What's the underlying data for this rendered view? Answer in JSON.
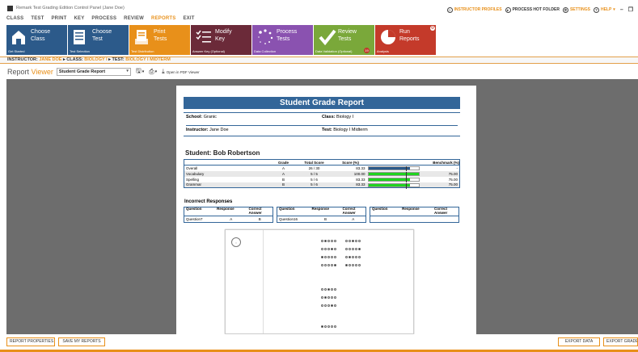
{
  "window": {
    "title": "Remark Test Grading Edition Control Panel (Jane Doe)"
  },
  "top_right": {
    "instructor_profiles": "INSTRUCTOR PROFILES",
    "process_hot_folder": "PROCESS HOT FOLDER",
    "settings": "SETTINGS",
    "help": "HELP"
  },
  "menu": [
    "CLASS",
    "TEST",
    "PRINT",
    "KEY",
    "PROCESS",
    "REVIEW",
    "REPORTS",
    "EXIT"
  ],
  "menu_active": "REPORTS",
  "ribbon": [
    {
      "label": "Choose\nClass",
      "sub": "Get Started",
      "color": "#2c5a8a",
      "icon": "house-icon"
    },
    {
      "label": "Choose\nTest",
      "sub": "Test Selection",
      "color": "#2c5a8a",
      "icon": "document-icon"
    },
    {
      "label": "Print\nTests",
      "sub": "Test Distribution",
      "color": "#e8901a",
      "icon": "printer-doc-icon"
    },
    {
      "label": "Modify\nKey",
      "sub": "Answer Key (Optional)",
      "color": "#6b2a39",
      "icon": "checklist-icon"
    },
    {
      "label": "Process\nTests",
      "sub": "Data Collection",
      "color": "#8a52b0",
      "icon": "spinner-icon"
    },
    {
      "label": "Review\nTests",
      "sub": "Data Validation (Optional)",
      "color": "#7aa83a",
      "icon": "checkmark-icon",
      "warn": "19"
    },
    {
      "label": "Run\nReports",
      "sub": "Analysis",
      "color": "#c43a2a",
      "icon": "piechart-icon"
    }
  ],
  "breadcrumb": {
    "instructor_label": "INSTRUCTOR:",
    "instructor": "JANE DOE",
    "class_label": "CLASS:",
    "class": "BIOLOGY I",
    "test_label": "TEST:",
    "test": "BIOLOGY I MIDTERM"
  },
  "toolbar": {
    "report_label": "Report",
    "viewer_label": "Viewer",
    "selected_report": "Student Grade Report",
    "open_pdf": "Open in PDF Viewer"
  },
  "report": {
    "title": "Student Grade Report",
    "school_label": "School:",
    "school": "Granic",
    "class_label": "Class:",
    "class": "Biology I",
    "instructor_label": "Instructor:",
    "instructor": "Jane Doe",
    "test_label": "Test:",
    "test": "Biology I Midterm",
    "student_heading": "Student: Bob Robertson",
    "columns": [
      "",
      "Grade",
      "Total Score",
      "Score (%)",
      "",
      "Benchmark (%)"
    ],
    "rows": [
      {
        "name": "Overall",
        "grade": "A",
        "total": "26 / 30",
        "pct": "83.33",
        "bar": 0.8333,
        "bar_color": "#2c5a8a",
        "mark": 0.75,
        "benchmark": "-"
      },
      {
        "name": "Vocabulary",
        "grade": "A",
        "total": "5 / 5",
        "pct": "100.00",
        "bar": 1.0,
        "bar_color": "#1fd31f",
        "mark": 0.75,
        "benchmark": "75.00"
      },
      {
        "name": "Spelling",
        "grade": "B",
        "total": "5 / 6",
        "pct": "83.33",
        "bar": 0.8333,
        "bar_color": "#1fd31f",
        "mark": 0.75,
        "benchmark": "75.00"
      },
      {
        "name": "Grammar",
        "grade": "B",
        "total": "5 / 6",
        "pct": "83.33",
        "bar": 0.8333,
        "bar_color": "#1fd31f",
        "mark": 0.75,
        "benchmark": "75.00"
      }
    ],
    "incorrect_title": "Incorrect Responses",
    "inc_headers": [
      "Question",
      "Response",
      "Correct\nAnswer"
    ],
    "incorrect": [
      {
        "question": "Question7",
        "response": "A",
        "correct": "B"
      },
      {
        "question": "Question16",
        "response": "B",
        "correct": "A"
      },
      {
        "question": "",
        "response": "",
        "correct": ""
      }
    ]
  },
  "footer": {
    "report_properties": "REPORT PROPERTIES",
    "save_my_reports": "SAVE MY REPORTS",
    "export_data": "EXPORT DATA",
    "export_gradebook": "EXPORT GRADEBOOK"
  }
}
